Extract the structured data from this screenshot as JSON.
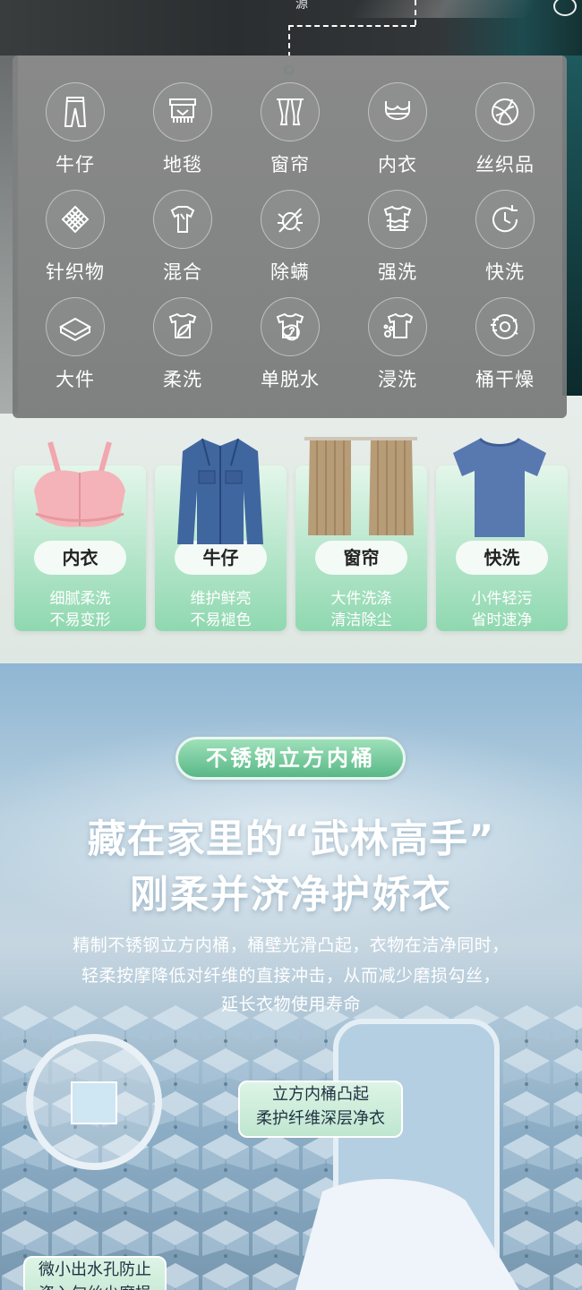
{
  "top_strip": {
    "text": "源"
  },
  "modes": [
    {
      "label": "牛仔",
      "icon": "jeans-icon"
    },
    {
      "label": "地毯",
      "icon": "carpet-icon"
    },
    {
      "label": "窗帘",
      "icon": "curtain-icon"
    },
    {
      "label": "内衣",
      "icon": "underwear-icon"
    },
    {
      "label": "丝织品",
      "icon": "silk-icon"
    },
    {
      "label": "针织物",
      "icon": "knit-icon"
    },
    {
      "label": "混合",
      "icon": "mixed-icon"
    },
    {
      "label": "除螨",
      "icon": "anti-mite-icon"
    },
    {
      "label": "强洗",
      "icon": "strong-wash-icon"
    },
    {
      "label": "快洗",
      "icon": "quick-wash-icon"
    },
    {
      "label": "大件",
      "icon": "bulky-icon"
    },
    {
      "label": "柔洗",
      "icon": "gentle-wash-icon"
    },
    {
      "label": "单脱水",
      "icon": "spin-only-icon"
    },
    {
      "label": "浸洗",
      "icon": "soak-wash-icon"
    },
    {
      "label": "桶干燥",
      "icon": "drum-dry-icon"
    }
  ],
  "cards": [
    {
      "title": "内衣",
      "line1": "细腻柔洗",
      "line2": "不易变形",
      "image": "sports-bra"
    },
    {
      "title": "牛仔",
      "line1": "维护鲜亮",
      "line2": "不易褪色",
      "image": "denim-jacket"
    },
    {
      "title": "窗帘",
      "line1": "大件洗涤",
      "line2": "清洁除尘",
      "image": "curtains"
    },
    {
      "title": "快洗",
      "line1": "小件轻污",
      "line2": "省时速净",
      "image": "t-shirt"
    }
  ],
  "feature": {
    "badge": "不锈钢立方内桶",
    "headline1": "藏在家里的“武林高手”",
    "headline2": "刚柔并济净护娇衣",
    "desc1": "精制不锈钢立方内桶，桶壁光滑凸起，衣物在洁净同时，",
    "desc2": "轻柔按摩降低对纤维的直接冲击，从而减少磨损勾丝，",
    "desc3": "延长衣物使用寿命",
    "callout1_l1": "立方内桶凸起",
    "callout1_l2": "柔护纤维深层净衣",
    "callout2_l1": "微小出水孔防止",
    "callout2_l2": "瓷入勾丝少磨损"
  },
  "colors": {
    "accent_green": "#59b887",
    "panel_gray": "#808282",
    "blue_bg": "#8fb6d3"
  }
}
